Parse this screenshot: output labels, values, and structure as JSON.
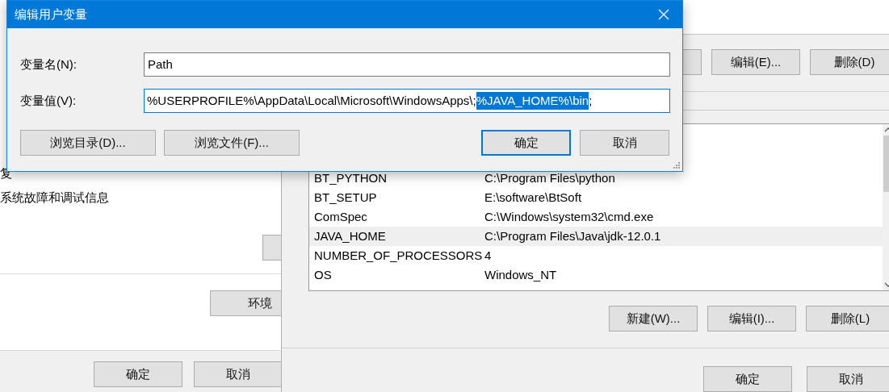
{
  "background_window": {
    "texts": [
      "复",
      "系统故障和调试信息"
    ],
    "env_button": "环境",
    "buttons": [
      "确定",
      "取消"
    ]
  },
  "env_window": {
    "top_buttons": [
      "编辑(E)...",
      "删除(D)"
    ],
    "rows": [
      {
        "name": "BT_PYTHON",
        "value": "C:\\Program Files\\python",
        "selected": false
      },
      {
        "name": "BT_SETUP",
        "value": "E:\\software\\BtSoft",
        "selected": false
      },
      {
        "name": "ComSpec",
        "value": "C:\\Windows\\system32\\cmd.exe",
        "selected": false
      },
      {
        "name": "JAVA_HOME",
        "value": "C:\\Program Files\\Java\\jdk-12.0.1",
        "selected": true
      },
      {
        "name": "NUMBER_OF_PROCESSORS",
        "value": "4",
        "selected": false
      },
      {
        "name": "OS",
        "value": "Windows_NT",
        "selected": false
      }
    ],
    "list_buttons": [
      "新建(W)...",
      "编辑(I)...",
      "删除(L)"
    ],
    "buttons": [
      "确定",
      "取消"
    ]
  },
  "dialog": {
    "title": "编辑用户变量",
    "name_label": "变量名(N):",
    "name_value": "Path",
    "value_label": "变量值(V):",
    "value_before": "%USERPROFILE%\\AppData\\Local\\Microsoft\\WindowsApps\\;",
    "value_selected": "%JAVA_HOME%\\bin",
    "value_after": ";",
    "browse_buttons": [
      "浏览目录(D)...",
      "浏览文件(F)..."
    ],
    "buttons": [
      {
        "label": "确定",
        "focused": true
      },
      {
        "label": "取消",
        "focused": false
      }
    ]
  }
}
